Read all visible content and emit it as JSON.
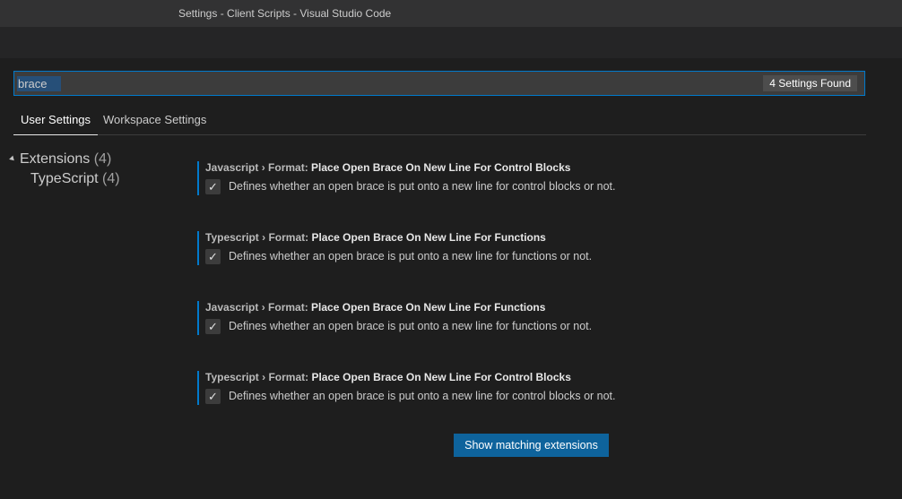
{
  "window": {
    "title": "Settings - Client Scripts - Visual Studio Code"
  },
  "search": {
    "value": "brace",
    "result_count": "4 Settings Found"
  },
  "tabs": [
    {
      "label": "User Settings",
      "active": true
    },
    {
      "label": "Workspace Settings",
      "active": false
    }
  ],
  "tree": [
    {
      "label": "Extensions",
      "count": "(4)",
      "expanded": true
    },
    {
      "label": "TypeScript",
      "count": "(4)"
    }
  ],
  "settings": [
    {
      "category": "Javascript › Format:",
      "name": "Place Open Brace On New Line For Control Blocks",
      "checked": true,
      "description": "Defines whether an open brace is put onto a new line for control blocks or not."
    },
    {
      "category": "Typescript › Format:",
      "name": "Place Open Brace On New Line For Functions",
      "checked": true,
      "description": "Defines whether an open brace is put onto a new line for functions or not."
    },
    {
      "category": "Javascript › Format:",
      "name": "Place Open Brace On New Line For Functions",
      "checked": true,
      "description": "Defines whether an open brace is put onto a new line for functions or not."
    },
    {
      "category": "Typescript › Format:",
      "name": "Place Open Brace On New Line For Control Blocks",
      "checked": true,
      "description": "Defines whether an open brace is put onto a new line for control blocks or not."
    }
  ],
  "checkbox_glyph": "✓",
  "show_extensions_label": "Show matching extensions",
  "colors": {
    "accent": "#007acc",
    "button": "#0e639c",
    "background": "#1e1e1e"
  }
}
